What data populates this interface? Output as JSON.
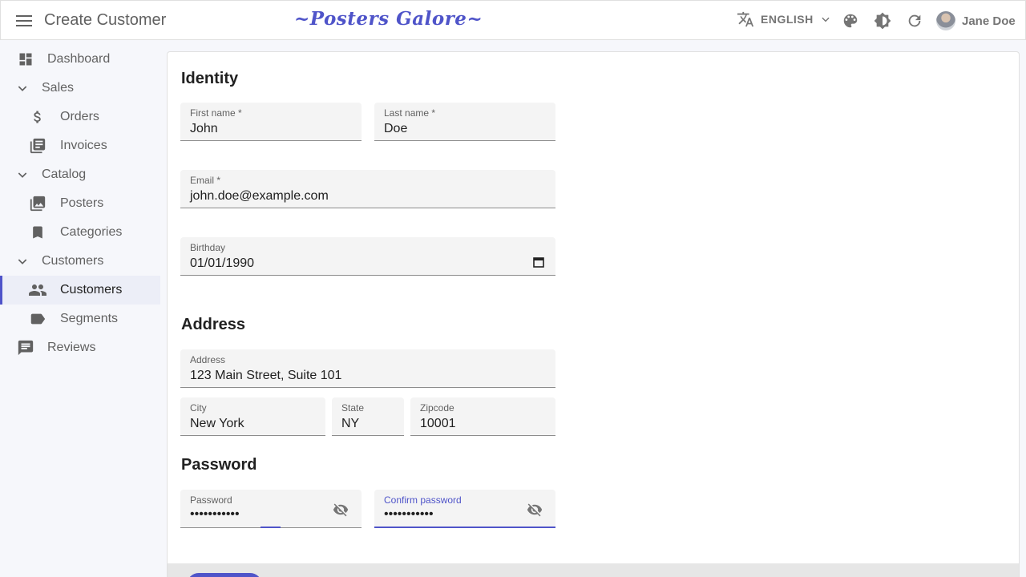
{
  "appbar": {
    "page_title": "Create Customer",
    "brand": "~Posters Galore~",
    "language": "ENGLISH",
    "user_name": "Jane Doe"
  },
  "sidebar": {
    "items": [
      {
        "label": "Dashboard",
        "icon": "dashboard-icon"
      },
      {
        "label": "Sales",
        "icon": "chevron-down-icon"
      },
      {
        "label": "Orders",
        "icon": "dollar-icon"
      },
      {
        "label": "Invoices",
        "icon": "invoices-icon"
      },
      {
        "label": "Catalog",
        "icon": "chevron-down-icon"
      },
      {
        "label": "Posters",
        "icon": "posters-icon"
      },
      {
        "label": "Categories",
        "icon": "bookmark-icon"
      },
      {
        "label": "Customers",
        "icon": "chevron-down-icon"
      },
      {
        "label": "Customers",
        "icon": "people-icon",
        "active": true
      },
      {
        "label": "Segments",
        "icon": "label-icon"
      },
      {
        "label": "Reviews",
        "icon": "comment-icon"
      }
    ]
  },
  "form": {
    "identity_title": "Identity",
    "first_name": {
      "label": "First name *",
      "value": "John"
    },
    "last_name": {
      "label": "Last name *",
      "value": "Doe"
    },
    "email": {
      "label": "Email *",
      "value": "john.doe@example.com"
    },
    "birthday": {
      "label": "Birthday",
      "value": "01/01/1990"
    },
    "address_title": "Address",
    "address": {
      "label": "Address",
      "value": "123 Main Street, Suite 101"
    },
    "city": {
      "label": "City",
      "value": "New York"
    },
    "state": {
      "label": "State",
      "value": "NY"
    },
    "zipcode": {
      "label": "Zipcode",
      "value": "10001"
    },
    "password_title": "Password",
    "password": {
      "label": "Password",
      "value": "•••••••••••"
    },
    "confirm_password": {
      "label": "Confirm password",
      "value": "•••••••••••"
    }
  },
  "colors": {
    "accent": "#4f54c9",
    "sidebar_bg": "#f6f7fb",
    "field_bg": "#f4f4f4"
  }
}
